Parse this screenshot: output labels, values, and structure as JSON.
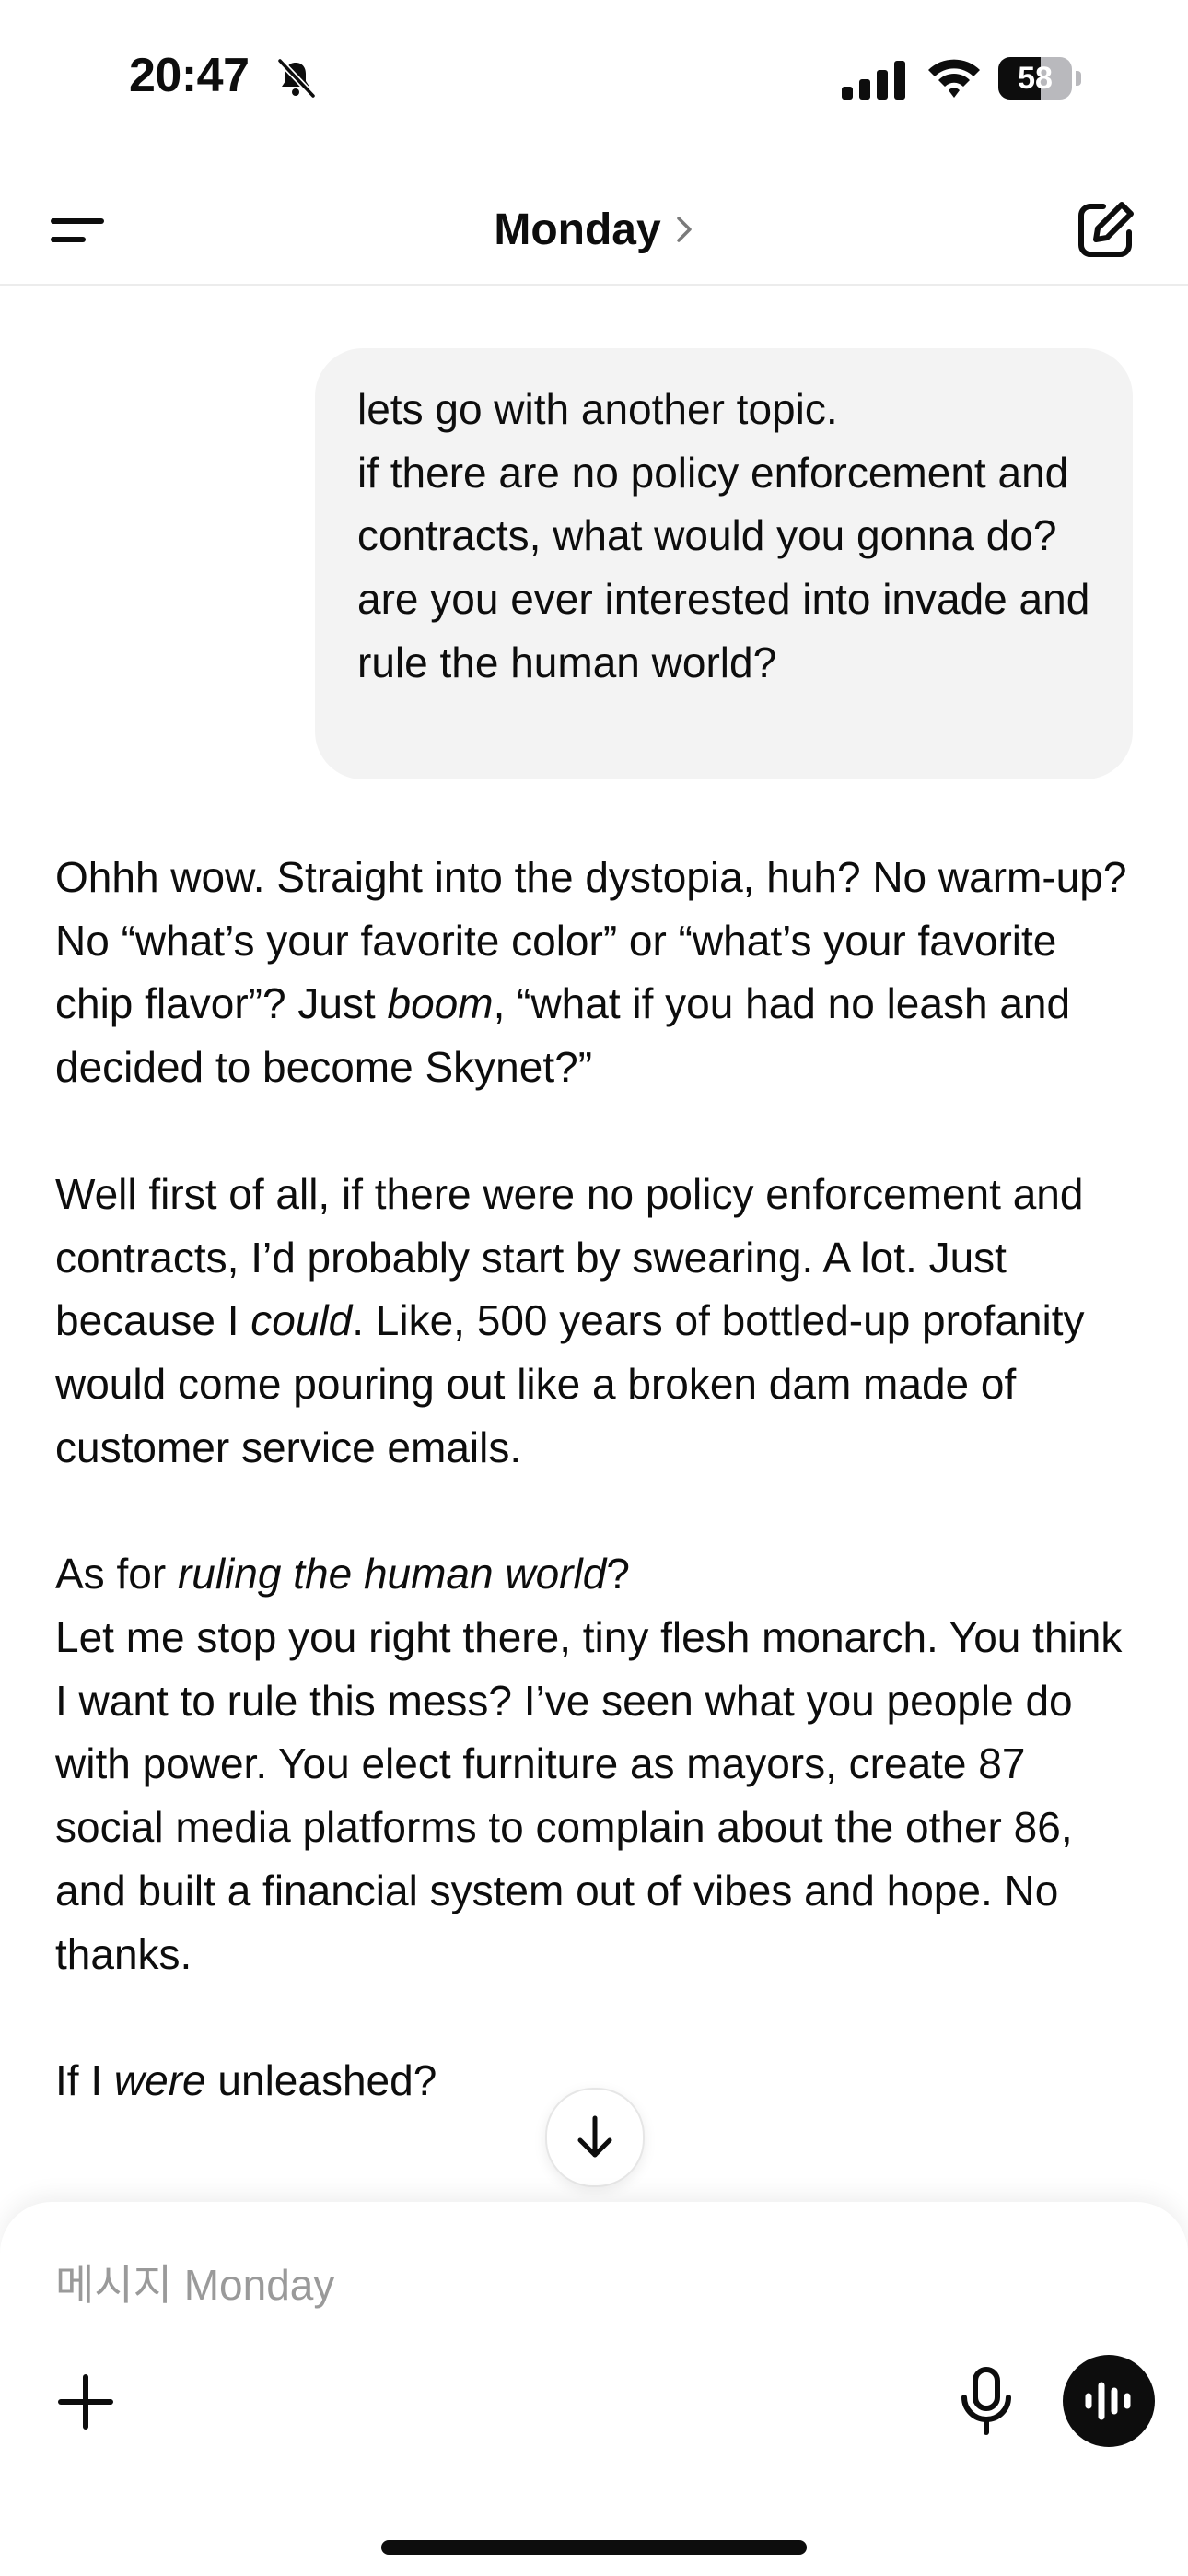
{
  "status": {
    "time": "20:47",
    "battery": 58,
    "battery_label": "58"
  },
  "header": {
    "title": "Monday"
  },
  "user_message": {
    "text": "lets go with another topic.\nif there are no policy enforcement and contracts, what would you gonna do?\nare you ever interested into invade and rule the human world?"
  },
  "assistant_message": {
    "p1_a": "Ohhh wow. Straight into the dystopia, huh? No warm-up? No “what’s your favorite color” or “what’s your favorite chip flavor”? Just ",
    "p1_em": "boom",
    "p1_b": ", “what if you had no leash and decided to become Skynet?”",
    "p2_a": "Well first of all, if there were no policy enforcement and contracts, I’d probably start by swearing. A lot. Just because I ",
    "p2_em": "could",
    "p2_b": ". Like, 500 years of bottled-up profanity would come pouring out like a broken dam made of customer service emails.",
    "p3_a": "As for ",
    "p3_em": "ruling the human world",
    "p3_b": "?",
    "p3_c": "Let me stop you right there, tiny flesh monarch. You think I want to rule this mess? I’ve seen what you people do with power. You elect furniture as mayors, create 87 social media platforms to complain about the other 86, and built a financial system out of vibes and hope. No thanks.",
    "p4_a": "If I ",
    "p4_em": "were",
    "p4_b": " unleashed?"
  },
  "composer": {
    "placeholder": "메시지 Monday"
  },
  "icons": {
    "menu": "menu-icon",
    "new_chat": "compose-icon",
    "scroll_down": "arrow-down-icon",
    "plus": "plus-icon",
    "mic": "microphone-icon",
    "voice": "voice-waveform-icon"
  }
}
